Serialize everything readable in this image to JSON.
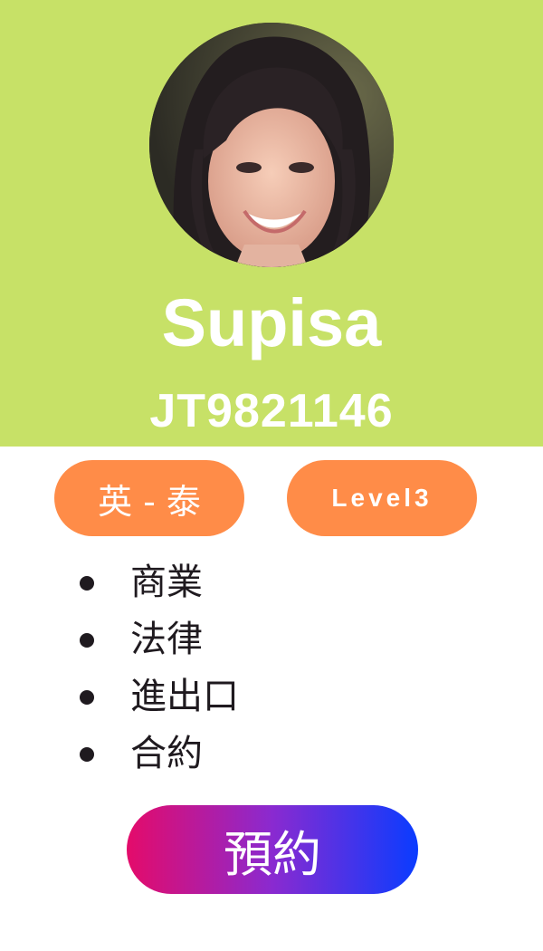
{
  "profile": {
    "name": "Supisa",
    "code": "JT9821146",
    "avatar_alt": "profile photo"
  },
  "tags": {
    "language_pair": "英 - 泰",
    "level": "Level3"
  },
  "topics": [
    "商業",
    "法律",
    "進出口",
    "合約"
  ],
  "actions": {
    "book_label": "預約"
  },
  "colors": {
    "header_bg": "#c7e167",
    "tag_bg": "#ff8c48",
    "book_gradient_start": "#e40b6a",
    "book_gradient_end": "#0a3cff"
  }
}
